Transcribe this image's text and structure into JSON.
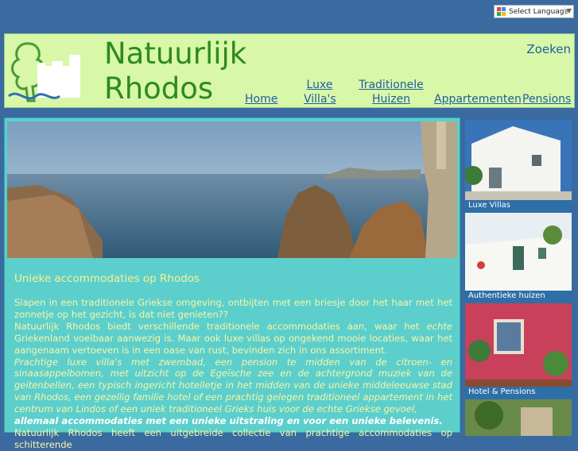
{
  "language": {
    "label": "Select Language",
    "arrow": "▼",
    "icon": "google-icon"
  },
  "header": {
    "title_line1": "Natuurlijk",
    "title_line2": "Rhodos",
    "search": "Zoeken",
    "nav": {
      "home": "Home",
      "luxe_line1": "Luxe",
      "luxe_line2": "Villa's",
      "trad_line1": "Traditionele",
      "trad_line2": "Huizen",
      "appartementen": "Appartementen",
      "pensions": "Pensions"
    }
  },
  "main": {
    "subtitle": "Unieke accommodaties op Rhodos",
    "p1": "Slapen in een traditionele Griekse omgeving, ontbijten met een briesje door het haar met het zonnetje op het gezicht, is dat niet genieten??",
    "p2_a": "Natuurlijk Rhodos biedt verschillende traditionele accommodaties aan, waar het ",
    "p2_em": "echte",
    "p2_b": " Griekenland voelbaar aanwezig is. Maar ook luxe villas op ongekend mooie locaties, waar het aangenaam vertoeven is in een oase van rust, bevinden zich in ons assortiment.",
    "p3": "Prachtige luxe villa's met zwembad, een pension te midden van de citroen- en sinaasappelbomen, met uitzicht op de Egeïsche zee en de achtergrond muziek van de geitenbellen, een typisch ingericht hotelletje in het midden van de unieke middeleeuwse stad van Rhodos, een gezellig familie hotel of een prachtig gelegen traditioneel appartement in het centrum van Lindos of een uniek traditioneel Grieks huis voor de echte Griekse gevoel,",
    "p3_strong": "allemaal accommodaties met een unieke uitstraling en voor een unieke belevenis.",
    "p4": "Natuurlijk Rhodos heeft een uitgebreide collectie van prachtige accommodaties op schitterende"
  },
  "sidebar": {
    "items": [
      {
        "caption": "Luxe Villas"
      },
      {
        "caption": "Authentieke huizen"
      },
      {
        "caption": "Hotel & Pensions"
      }
    ]
  },
  "colors": {
    "page_bg": "#3a6aa0",
    "header_bg": "#d8f7a8",
    "content_bg": "#5ccfcc",
    "link": "#2060a0",
    "title": "#2d8a1e"
  }
}
